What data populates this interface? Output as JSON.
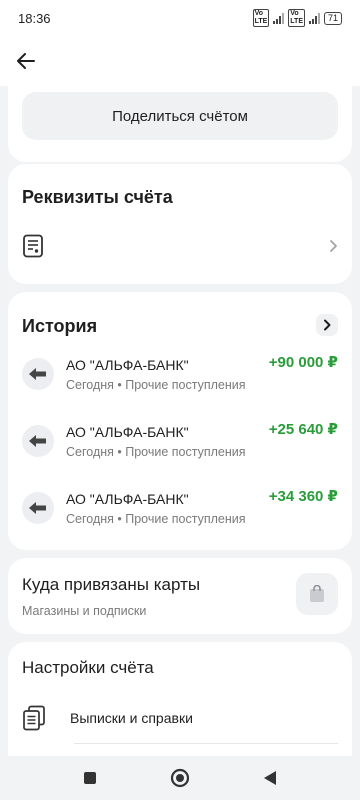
{
  "status_bar": {
    "time": "18:36",
    "network_label": "4G",
    "volte_label": "Vo LTE",
    "battery": "71"
  },
  "header": {
    "back_icon": "arrow-left-icon"
  },
  "share": {
    "label": "Поделиться счётом"
  },
  "requisites": {
    "title": "Реквизиты счёта",
    "icon": "document-icon"
  },
  "history": {
    "title": "История",
    "items": [
      {
        "name": "АО \"АЛЬФА-БАНК\"",
        "subtitle": "Сегодня • Прочие поступления",
        "amount": "+90 000 ₽"
      },
      {
        "name": "АО \"АЛЬФА-БАНК\"",
        "subtitle": "Сегодня • Прочие поступления",
        "amount": "+25 640 ₽"
      },
      {
        "name": "АО \"АЛЬФА-БАНК\"",
        "subtitle": "Сегодня • Прочие поступления",
        "amount": "+34 360 ₽"
      }
    ]
  },
  "linked_cards": {
    "title": "Куда привязаны карты",
    "subtitle": "Магазины и подписки",
    "icon": "shopping-bag-icon"
  },
  "settings": {
    "title": "Настройки счёта",
    "rows": [
      {
        "label": "Выписки и справки",
        "icon": "documents-stack-icon"
      }
    ]
  },
  "colors": {
    "accent_positive": "#2a9d3a",
    "background": "#f2f3f5",
    "card": "#ffffff"
  }
}
